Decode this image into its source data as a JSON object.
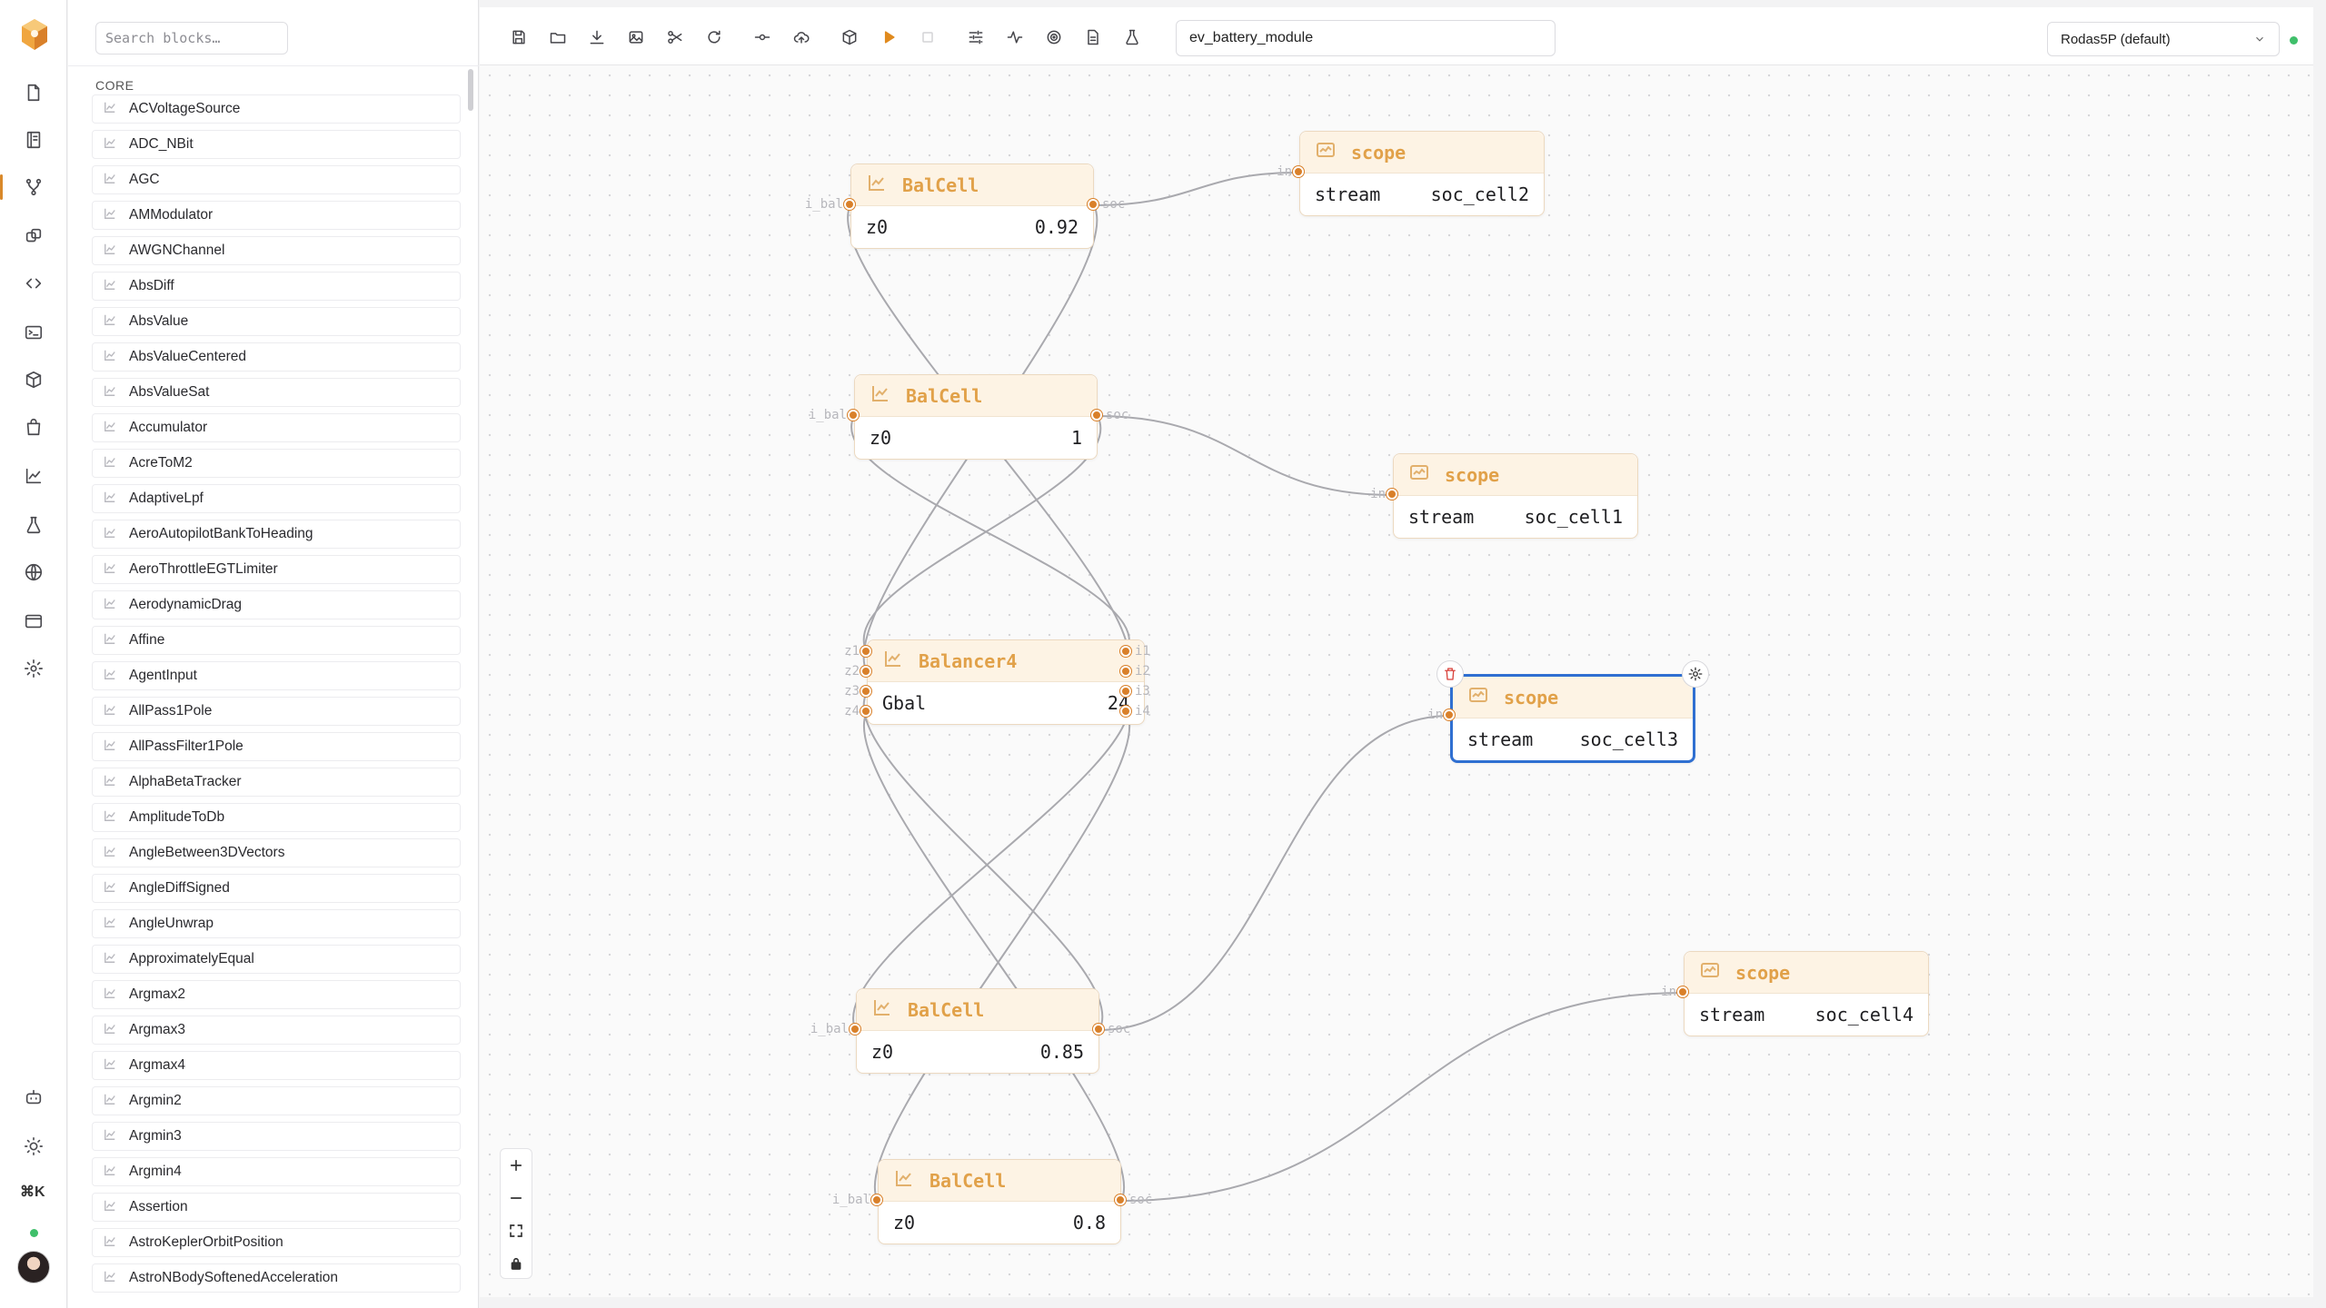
{
  "sidebar": {
    "search_placeholder": "Search blocks…",
    "category": "CORE",
    "blocks": [
      "ACVoltageSource",
      "ADC_NBit",
      "AGC",
      "AMModulator",
      "AWGNChannel",
      "AbsDiff",
      "AbsValue",
      "AbsValueCentered",
      "AbsValueSat",
      "Accumulator",
      "AcreToM2",
      "AdaptiveLpf",
      "AeroAutopilotBankToHeading",
      "AeroThrottleEGTLimiter",
      "AerodynamicDrag",
      "Affine",
      "AgentInput",
      "AllPass1Pole",
      "AllPassFilter1Pole",
      "AlphaBetaTracker",
      "AmplitudeToDb",
      "AngleBetween3DVectors",
      "AngleDiffSigned",
      "AngleUnwrap",
      "ApproximatelyEqual",
      "Argmax2",
      "Argmax3",
      "Argmax4",
      "Argmin2",
      "Argmin3",
      "Argmin4",
      "Assertion",
      "AstroKeplerOrbitPosition",
      "AstroNBodySoftenedAcceleration"
    ]
  },
  "toolbar": {
    "model_name": "ev_battery_module",
    "solver": "Rodas5P (default)"
  },
  "rail": {
    "shortcut": "⌘K"
  },
  "nodes": {
    "balcell_a": {
      "title": "BalCell",
      "param": "z0",
      "value": "0.92",
      "in_port": "i_bal",
      "out_port": "soc"
    },
    "balcell_b": {
      "title": "BalCell",
      "param": "z0",
      "value": "1",
      "in_port": "i_bal",
      "out_port": "soc"
    },
    "balancer": {
      "title": "Balancer4",
      "param": "Gbal",
      "value": "24",
      "in_ports": [
        "z1",
        "z2",
        "z3",
        "z4"
      ],
      "out_ports": [
        "i1",
        "i2",
        "i3",
        "i4"
      ]
    },
    "balcell_c": {
      "title": "BalCell",
      "param": "z0",
      "value": "0.85",
      "in_port": "i_bal",
      "out_port": "soc"
    },
    "balcell_d": {
      "title": "BalCell",
      "param": "z0",
      "value": "0.8",
      "in_port": "i_bal",
      "out_port": "soc"
    },
    "scope_1": {
      "title": "scope",
      "param": "stream",
      "value": "soc_cell2",
      "in_port": "in"
    },
    "scope_2": {
      "title": "scope",
      "param": "stream",
      "value": "soc_cell1",
      "in_port": "in"
    },
    "scope_3": {
      "title": "scope",
      "param": "stream",
      "value": "soc_cell3",
      "in_port": "in"
    },
    "scope_4": {
      "title": "scope",
      "param": "stream",
      "value": "soc_cell4",
      "in_port": "in"
    }
  },
  "colors": {
    "accent": "#d9802a",
    "node_title": "#e1a149",
    "selected": "#2f6fd1",
    "status_ok": "#3fbf6a"
  }
}
